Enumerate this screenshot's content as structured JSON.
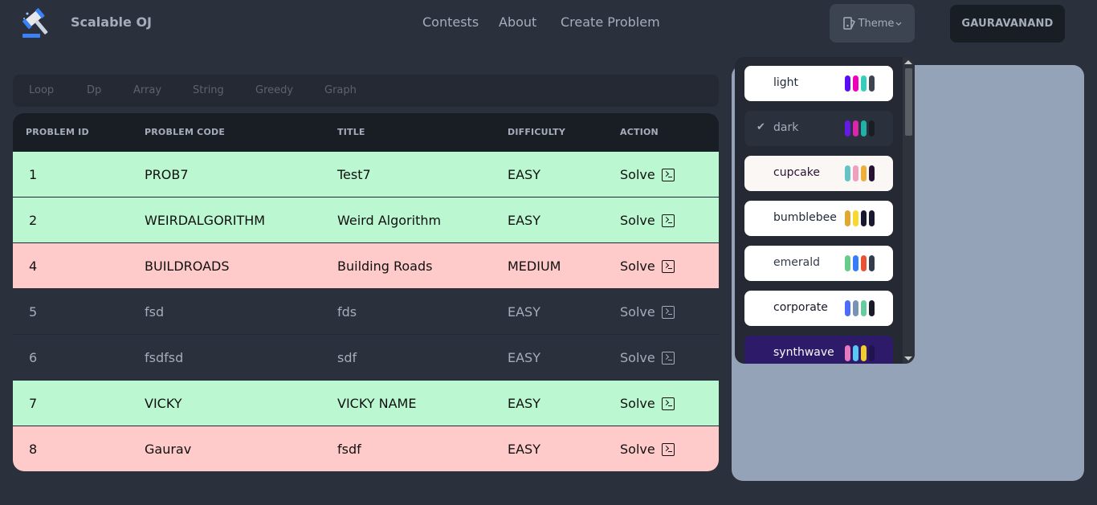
{
  "navbar": {
    "brand": "Scalable OJ",
    "links": [
      "Contests",
      "About",
      "Create Problem"
    ],
    "theme_label": "Theme",
    "user_label": "GAURAVANAND"
  },
  "tags": [
    "Loop",
    "Dp",
    "Array",
    "String",
    "Greedy",
    "Graph"
  ],
  "table": {
    "headers": [
      "PROBLEM ID",
      "PROBLEM CODE",
      "TITLE",
      "DIFFICULTY",
      "ACTION"
    ],
    "rows": [
      {
        "id": "1",
        "code": "PROB7",
        "title": "Test7",
        "difficulty": "EASY",
        "action": "Solve",
        "status": "solved"
      },
      {
        "id": "2",
        "code": "WEIRDALGORITHM",
        "title": "Weird Algorithm",
        "difficulty": "EASY",
        "action": "Solve",
        "status": "solved"
      },
      {
        "id": "4",
        "code": "BUILDROADS",
        "title": "Building Roads",
        "difficulty": "MEDIUM",
        "action": "Solve",
        "status": "attempted"
      },
      {
        "id": "5",
        "code": "fsd",
        "title": "fds",
        "difficulty": "EASY",
        "action": "Solve",
        "status": "none"
      },
      {
        "id": "6",
        "code": "fsdfsd",
        "title": "sdf",
        "difficulty": "EASY",
        "action": "Solve",
        "status": "none"
      },
      {
        "id": "7",
        "code": "VICKY",
        "title": "VICKY NAME",
        "difficulty": "EASY",
        "action": "Solve",
        "status": "solved"
      },
      {
        "id": "8",
        "code": "Gaurav",
        "title": "fsdf",
        "difficulty": "EASY",
        "action": "Solve",
        "status": "attempted"
      }
    ]
  },
  "themes": [
    {
      "name": "light",
      "selected": false,
      "bg": "#ffffff",
      "fg": "#1f2937",
      "colors": [
        "#570df8",
        "#f000b8",
        "#37cdbe",
        "#3d4451"
      ]
    },
    {
      "name": "dark",
      "selected": true,
      "bg": "#2a303c",
      "fg": "#a6adba",
      "colors": [
        "#661ae6",
        "#d926aa",
        "#1fb2a5",
        "#191d24"
      ]
    },
    {
      "name": "cupcake",
      "selected": false,
      "bg": "#faf7f5",
      "fg": "#291334",
      "colors": [
        "#65c3c8",
        "#ef9fbc",
        "#eeaf3a",
        "#291334"
      ]
    },
    {
      "name": "bumblebee",
      "selected": false,
      "bg": "#ffffff",
      "fg": "#1f2937",
      "colors": [
        "#e0a82e",
        "#f9d72f",
        "#181830",
        "#181830"
      ]
    },
    {
      "name": "emerald",
      "selected": false,
      "bg": "#ffffff",
      "fg": "#333c4d",
      "colors": [
        "#66cc8a",
        "#377cfb",
        "#ea5234",
        "#333c4d"
      ]
    },
    {
      "name": "corporate",
      "selected": false,
      "bg": "#ffffff",
      "fg": "#181a2a",
      "colors": [
        "#4b6bfb",
        "#7b92b2",
        "#67cba0",
        "#181a2a"
      ]
    },
    {
      "name": "synthwave",
      "selected": false,
      "bg": "#2d1b69",
      "fg": "#f9f7fd",
      "colors": [
        "#e779c1",
        "#58c7f3",
        "#f3cc30",
        "#20134e"
      ]
    }
  ],
  "colors": {
    "solved_row": "#bbf7d0",
    "attempted_row": "#fecaca",
    "panel": "#94a3b8"
  }
}
